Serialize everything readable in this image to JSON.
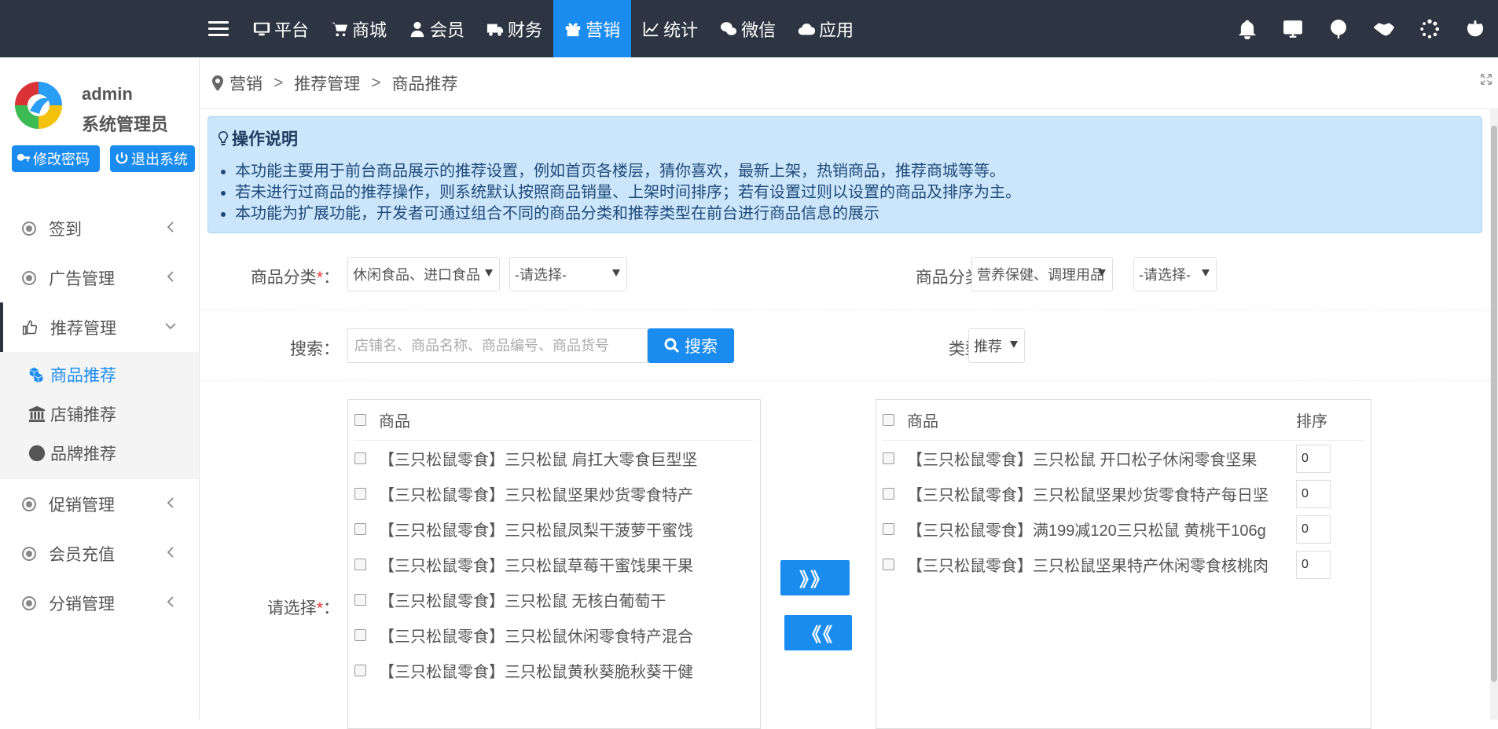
{
  "colors": {
    "topbar": "#2d3442",
    "accent": "#1a8cf0",
    "notice_bg": "#cbe6fb"
  },
  "topnav": {
    "items": [
      {
        "label": "平台",
        "icon": "monitor-icon"
      },
      {
        "label": "商城",
        "icon": "cart-icon"
      },
      {
        "label": "会员",
        "icon": "user-icon"
      },
      {
        "label": "财务",
        "icon": "truck-icon"
      },
      {
        "label": "营销",
        "icon": "gift-icon",
        "active": true
      },
      {
        "label": "统计",
        "icon": "line-chart-icon"
      },
      {
        "label": "微信",
        "icon": "wechat-icon"
      },
      {
        "label": "应用",
        "icon": "cloud-icon"
      }
    ],
    "right_icons": [
      "bell-icon",
      "screen-icon",
      "location-icon",
      "handshake-icon",
      "spinner-icon",
      "power-icon"
    ]
  },
  "sidebar": {
    "user_name": "admin",
    "user_role": "系统管理员",
    "change_password": "修改密码",
    "logout": "退出系统",
    "menu": [
      {
        "label": "签到"
      },
      {
        "label": "广告管理"
      },
      {
        "label": "推荐管理",
        "open": true
      },
      {
        "label": "促销管理"
      },
      {
        "label": "会员充值"
      },
      {
        "label": "分销管理"
      }
    ],
    "submenu": [
      {
        "label": "商品推荐",
        "icon": "cubes-icon",
        "active": true
      },
      {
        "label": "店铺推荐",
        "icon": "bank-icon"
      },
      {
        "label": "品牌推荐",
        "icon": "registered-icon"
      }
    ]
  },
  "breadcrumb": [
    "营销",
    "推荐管理",
    "商品推荐"
  ],
  "notice": {
    "title": "操作说明",
    "items": [
      "本功能主要用于前台商品展示的推荐设置，例如首页各楼层，猜你喜欢，最新上架，热销商品，推荐商城等等。",
      "若未进行过商品的推荐操作，则系统默认按照商品销量、上架时间排序；若有设置过则以设置的商品及排序为主。",
      "本功能为扩展功能，开发者可通过组合不同的商品分类和推荐类型在前台进行商品信息的展示"
    ]
  },
  "form": {
    "category_label": "商品分类",
    "req": "*",
    "colon": "：",
    "left_category_1": "休闲食品、进口食品",
    "left_category_2": "-请选择-",
    "right_category_1": "营养保健、调理用品",
    "right_category_2": "-请选择-",
    "search_label": "搜索",
    "search_placeholder": "店铺名、商品名称、商品编号、商品货号",
    "search_button": "搜索",
    "type_label": "类型",
    "type_value": "推荐",
    "select_label": "请选择"
  },
  "left_list": {
    "header": "商品",
    "items": [
      "【三只松鼠零食】三只松鼠 肩扛大零食巨型坚",
      "【三只松鼠零食】三只松鼠坚果炒货零食特产",
      "【三只松鼠零食】三只松鼠凤梨干菠萝干蜜饯",
      "【三只松鼠零食】三只松鼠草莓干蜜饯果干果",
      "【三只松鼠零食】三只松鼠 无核白葡萄干",
      "【三只松鼠零食】三只松鼠休闲零食特产混合",
      "【三只松鼠零食】三只松鼠黄秋葵脆秋葵干健"
    ]
  },
  "right_list": {
    "header": "商品",
    "sort_header": "排序",
    "items": [
      {
        "name": "【三只松鼠零食】三只松鼠 开口松子休闲零食坚果",
        "sort": "0"
      },
      {
        "name": "【三只松鼠零食】三只松鼠坚果炒货零食特产每日坚",
        "sort": "0"
      },
      {
        "name": "【三只松鼠零食】满199减120三只松鼠 黄桃干106g",
        "sort": "0"
      },
      {
        "name": "【三只松鼠零食】三只松鼠坚果特产休闲零食核桃肉",
        "sort": "0"
      }
    ]
  },
  "transfer": {
    "add": "》》",
    "remove": "《《"
  }
}
